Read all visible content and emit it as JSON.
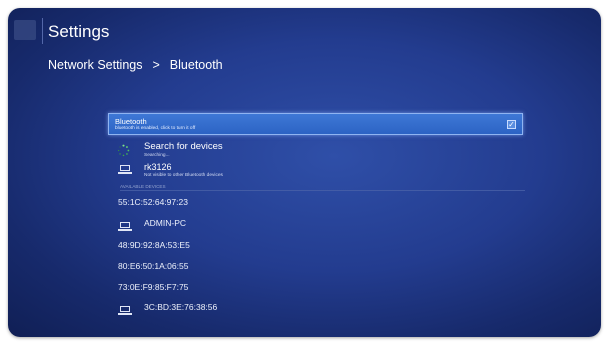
{
  "app": {
    "title": "Settings"
  },
  "breadcrumb": {
    "parent": "Network Settings",
    "separator": ">",
    "current": "Bluetooth"
  },
  "bluetooth": {
    "label": "Bluetooth",
    "status": "bluetooth is enabled, click to turn it off",
    "enabled": true,
    "check_glyph": "✓"
  },
  "search": {
    "label": "Search for devices",
    "status": "Searching..."
  },
  "this_device": {
    "name": "rk3126",
    "visibility": "Not visible to other Bluetooth devices"
  },
  "available": {
    "header": "AVAILABLE DEVICES",
    "devices": [
      {
        "name": "55:1C:52:64:97:23",
        "icon": "none"
      },
      {
        "name": "ADMIN-PC",
        "icon": "laptop-icon"
      },
      {
        "name": "48:9D:92:8A:53:E5",
        "icon": "none"
      },
      {
        "name": "80:E6:50:1A:06:55",
        "icon": "none"
      },
      {
        "name": "73:0E:F9:85:F7:75",
        "icon": "none"
      },
      {
        "name": "3C:BD:3E:76:38:56",
        "icon": "laptop-icon"
      }
    ]
  },
  "colors": {
    "accent": "#3e78d6",
    "background": "#233c8f",
    "text": "#ffffff"
  }
}
